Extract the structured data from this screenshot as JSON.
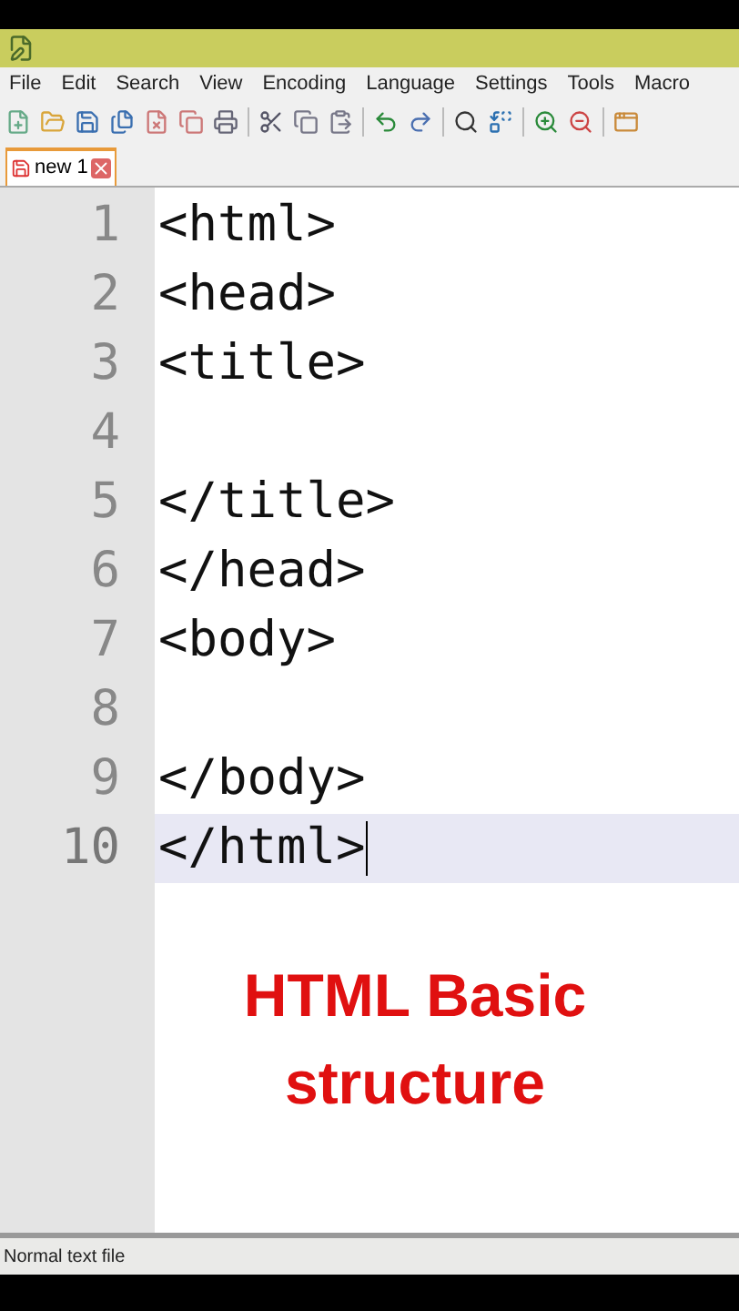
{
  "menu": [
    "File",
    "Edit",
    "Search",
    "View",
    "Encoding",
    "Language",
    "Settings",
    "Tools",
    "Macro"
  ],
  "tabs": [
    {
      "label": "new 1",
      "selected": true
    }
  ],
  "lines": [
    {
      "number": "1",
      "code": "<html>",
      "selected": false
    },
    {
      "number": "2",
      "code": "<head>",
      "selected": false
    },
    {
      "number": "3",
      "code": "<title>",
      "selected": false
    },
    {
      "number": "4",
      "selected": false
    },
    {
      "number": "5",
      "code": "</title>",
      "selected": false
    },
    {
      "number": "6",
      "code": "</head>",
      "selected": false
    },
    {
      "number": "7",
      "code": "<body>",
      "selected": false
    },
    {
      "number": "8",
      "selected": false
    },
    {
      "number": "9",
      "code": "</body>",
      "selected": false
    },
    {
      "number": "10",
      "code": "</html>",
      "selected": true
    }
  ],
  "caption": [
    "HTML Basic",
    "structure"
  ],
  "status_bar": "Normal text file"
}
